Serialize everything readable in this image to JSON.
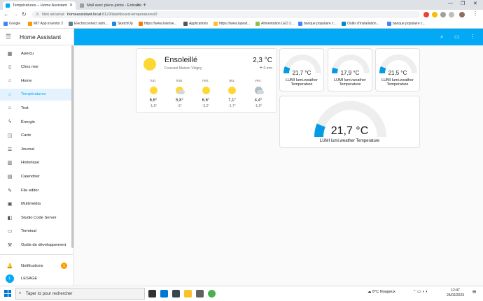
{
  "browser": {
    "tabs": [
      {
        "title": "Températures – Home Assistant",
        "active": true,
        "favicon_color": "#03a9f4"
      },
      {
        "title": "Mail avec pièce-jointe - Entraide",
        "active": false,
        "favicon_color": "#9e9e9e"
      }
    ],
    "address": {
      "security": "Non sécurisé",
      "host": "homeassistant.local",
      "path": ":8123/dashboard-temperatures/0"
    },
    "bookmarks": [
      {
        "label": "Google",
        "color": "#4285f4"
      },
      {
        "label": "MIT App Inventor 2",
        "color": "#ff9800"
      },
      {
        "label": "Electroconnect adm...",
        "color": "#607d8b"
      },
      {
        "label": "SketchUp",
        "color": "#1e88e5"
      },
      {
        "label": "https://www.loisirse...",
        "color": "#f57c00"
      },
      {
        "label": "Applications",
        "color": "#555555"
      },
      {
        "label": "https://www.lapost...",
        "color": "#fbc02d"
      },
      {
        "label": "Alimentation LED 2...",
        "color": "#8bc34a"
      },
      {
        "label": "banque populaire c...",
        "color": "#4285f4"
      },
      {
        "label": "Outils d'installation...",
        "color": "#0288d1"
      },
      {
        "label": "banque populaire c...",
        "color": "#4285f4"
      }
    ]
  },
  "sidebar": {
    "title": "Home Assistant",
    "items": [
      {
        "label": "Aperçu",
        "icon": "grid-icon",
        "glyph": "▦",
        "active": false
      },
      {
        "label": "Chez moi",
        "icon": "tablet-icon",
        "glyph": "▯",
        "active": false
      },
      {
        "label": "Home",
        "icon": "home-icon",
        "glyph": "⌂",
        "active": false
      },
      {
        "label": "Températures",
        "icon": "home-thermometer-icon",
        "glyph": "⌂",
        "active": true
      },
      {
        "label": "Test",
        "icon": "home-icon",
        "glyph": "⌂",
        "active": false
      },
      {
        "label": "Énergie",
        "icon": "lightning-icon",
        "glyph": "ϟ",
        "active": false
      },
      {
        "label": "Carte",
        "icon": "map-icon",
        "glyph": "◫",
        "active": false
      },
      {
        "label": "Journal",
        "icon": "list-icon",
        "glyph": "☰",
        "active": false
      },
      {
        "label": "Historique",
        "icon": "chart-icon",
        "glyph": "▥",
        "active": false
      },
      {
        "label": "Calendrier",
        "icon": "calendar-icon",
        "glyph": "▤",
        "active": false
      },
      {
        "label": "File editor",
        "icon": "wrench-icon",
        "glyph": "✎",
        "active": false
      },
      {
        "label": "Multimédia",
        "icon": "media-icon",
        "glyph": "▣",
        "active": false
      },
      {
        "label": "Studio Code Server",
        "icon": "code-icon",
        "glyph": "◧",
        "active": false
      },
      {
        "label": "Terminal",
        "icon": "terminal-icon",
        "glyph": "▭",
        "active": false
      },
      {
        "label": "Outils de développement",
        "icon": "hammer-icon",
        "glyph": "⚒",
        "active": false
      }
    ],
    "notifications": {
      "label": "Notifications",
      "count": "1"
    },
    "user": {
      "label": "LESAGE",
      "initial": "L"
    }
  },
  "topbar": {
    "icons": [
      "search-icon",
      "chat-icon",
      "more-vertical-icon"
    ]
  },
  "weather": {
    "state": "Ensoleillé",
    "name": "Forecast Maison Virigny",
    "temperature": "2,3 °C",
    "precipitation": "0 mm",
    "forecast": [
      {
        "day": "lun.",
        "hi": "6,6°",
        "lo": "-1,8°",
        "condition": "sunny"
      },
      {
        "day": "mar.",
        "hi": "5,8°",
        "lo": "-3°",
        "condition": "partly-cloudy"
      },
      {
        "day": "mer.",
        "hi": "6,6°",
        "lo": "-2,2°",
        "condition": "sunny"
      },
      {
        "day": "jeu.",
        "hi": "7,1°",
        "lo": "-1,7°",
        "condition": "sunny"
      },
      {
        "day": "ven.",
        "hi": "4,4°",
        "lo": "-1,8°",
        "condition": "cloudy"
      }
    ]
  },
  "gauges": [
    {
      "value": "21,7 °C",
      "fill": 0.12,
      "name": "LUMI lumi.weather Temperature"
    },
    {
      "value": "17,9 °C",
      "fill": 0.1,
      "name": "LUMI lumi.weather Temperature"
    },
    {
      "value": "21,5 °C",
      "fill": 0.12,
      "name": "LUMI lumi.weather Temperature"
    },
    {
      "value": "21,7 °C",
      "fill": 0.12,
      "name": "LUMI lumi.weather Temperature"
    }
  ],
  "colors": {
    "accent": "#03a9f4",
    "gauge_fill": "#039be5",
    "gauge_track": "#eeeeee"
  },
  "taskbar": {
    "search_placeholder": "Taper ici pour rechercher",
    "weather": "8°C Nuageux",
    "time": "12:47",
    "date": "26/02/2023"
  }
}
